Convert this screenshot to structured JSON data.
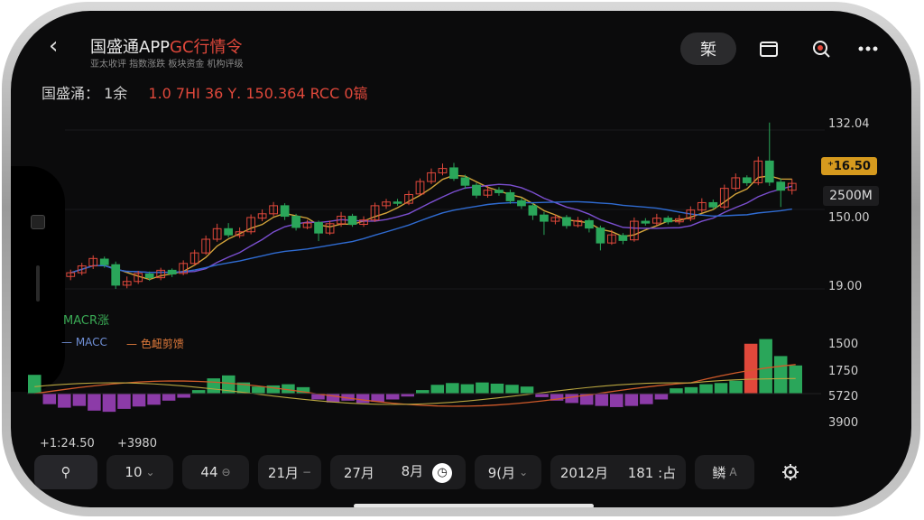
{
  "app": {
    "title_main": "国盛通APP",
    "title_red": "GC行情令",
    "subtitle": "亚太收评 指数涨跌 板块资金 机构评级"
  },
  "header_buttons": {
    "pill": "椠",
    "folder_icon": "folder-icon",
    "search_icon": "search-icon",
    "more_icon": "more-icon"
  },
  "ticker": {
    "name": "国盛涌：",
    "label": "1余",
    "values": "1.0 7ΗΙ  36 Υ.  150.364  RCC 0镐"
  },
  "y_axis_main": [
    "132.04",
    "150.00",
    "19.00"
  ],
  "price_tags": {
    "current": "⁺16.50",
    "volume": "2500M"
  },
  "y_axis_sub": [
    "1500",
    "1750",
    "5720",
    "3900"
  ],
  "labels": {
    "macd_top": "MACR涨",
    "legend_blue": "MACC",
    "legend_red": "色衄剪馈"
  },
  "stats": {
    "left": "+1:24.50",
    "right": "+3980"
  },
  "toolbar": {
    "items": [
      {
        "label": "⚲",
        "icon": "search-filter-icon"
      },
      {
        "label": "10",
        "sub": "⌄"
      },
      {
        "label": "44",
        "sub": "⊖"
      },
      {
        "label": "21月",
        "sub": "−"
      },
      {
        "label": "27月",
        "label2": "8月"
      },
      {
        "label": "9(月",
        "sub": "⌄"
      },
      {
        "label": "2012月",
        "label2": "181 :占"
      },
      {
        "label": "鳞",
        "sub": "A"
      }
    ],
    "settings_icon": "gear-icon"
  },
  "colors": {
    "up": "#e0483b",
    "down": "#2aa65a",
    "ma_fast": "#d2a33a",
    "ma_mid": "#7b4fd0",
    "ma_slow": "#2f6bd1",
    "macd_neg": "#8c3ba8"
  },
  "chart_data": {
    "type": "candlestick",
    "candles": [
      {
        "o": 19.2,
        "c": 19.8,
        "h": 20.3,
        "l": 18.6
      },
      {
        "o": 19.8,
        "c": 20.9,
        "h": 21.4,
        "l": 19.4
      },
      {
        "o": 20.9,
        "c": 22.1,
        "h": 22.6,
        "l": 20.4
      },
      {
        "o": 22.0,
        "c": 21.1,
        "h": 22.4,
        "l": 20.6
      },
      {
        "o": 21.1,
        "c": 17.8,
        "h": 21.6,
        "l": 17.2
      },
      {
        "o": 17.8,
        "c": 18.4,
        "h": 19.2,
        "l": 17.3
      },
      {
        "o": 18.4,
        "c": 19.7,
        "h": 20.1,
        "l": 18.0
      },
      {
        "o": 19.6,
        "c": 19.0,
        "h": 20.0,
        "l": 18.5
      },
      {
        "o": 19.0,
        "c": 20.2,
        "h": 20.6,
        "l": 18.6
      },
      {
        "o": 20.2,
        "c": 19.6,
        "h": 20.5,
        "l": 19.1
      },
      {
        "o": 19.7,
        "c": 21.3,
        "h": 21.8,
        "l": 19.4
      },
      {
        "o": 21.3,
        "c": 23.0,
        "h": 23.5,
        "l": 21.0
      },
      {
        "o": 23.0,
        "c": 25.2,
        "h": 25.8,
        "l": 22.7
      },
      {
        "o": 25.2,
        "c": 26.9,
        "h": 27.7,
        "l": 24.8
      },
      {
        "o": 26.9,
        "c": 25.9,
        "h": 27.8,
        "l": 25.5
      },
      {
        "o": 25.8,
        "c": 26.4,
        "h": 27.1,
        "l": 25.4
      },
      {
        "o": 26.4,
        "c": 28.7,
        "h": 29.2,
        "l": 26.0
      },
      {
        "o": 28.6,
        "c": 29.3,
        "h": 30.0,
        "l": 28.1
      },
      {
        "o": 29.3,
        "c": 30.6,
        "h": 31.2,
        "l": 28.9
      },
      {
        "o": 30.6,
        "c": 28.9,
        "h": 31.0,
        "l": 28.3
      },
      {
        "o": 28.9,
        "c": 27.1,
        "h": 29.3,
        "l": 26.6
      },
      {
        "o": 27.1,
        "c": 27.8,
        "h": 28.3,
        "l": 26.8
      },
      {
        "o": 27.9,
        "c": 26.2,
        "h": 28.2,
        "l": 24.9
      },
      {
        "o": 26.2,
        "c": 27.7,
        "h": 28.2,
        "l": 25.9
      },
      {
        "o": 27.7,
        "c": 28.9,
        "h": 29.6,
        "l": 27.2
      },
      {
        "o": 28.9,
        "c": 27.6,
        "h": 29.3,
        "l": 27.2
      },
      {
        "o": 27.6,
        "c": 28.3,
        "h": 28.9,
        "l": 27.2
      },
      {
        "o": 28.3,
        "c": 30.6,
        "h": 31.1,
        "l": 28.0
      },
      {
        "o": 30.6,
        "c": 31.2,
        "h": 31.7,
        "l": 30.1
      },
      {
        "o": 31.2,
        "c": 31.0,
        "h": 31.7,
        "l": 30.6
      },
      {
        "o": 31.0,
        "c": 32.4,
        "h": 33.0,
        "l": 30.7
      },
      {
        "o": 32.5,
        "c": 34.5,
        "h": 35.0,
        "l": 32.2
      },
      {
        "o": 34.5,
        "c": 35.9,
        "h": 36.6,
        "l": 34.1
      },
      {
        "o": 35.9,
        "c": 36.6,
        "h": 37.4,
        "l": 35.5
      },
      {
        "o": 36.7,
        "c": 35.0,
        "h": 37.5,
        "l": 34.6
      },
      {
        "o": 35.1,
        "c": 33.9,
        "h": 35.6,
        "l": 33.3
      },
      {
        "o": 33.9,
        "c": 32.3,
        "h": 34.3,
        "l": 31.8
      },
      {
        "o": 32.3,
        "c": 33.1,
        "h": 33.8,
        "l": 31.9
      },
      {
        "o": 33.1,
        "c": 32.7,
        "h": 33.6,
        "l": 32.2
      },
      {
        "o": 32.7,
        "c": 31.4,
        "h": 33.2,
        "l": 30.9
      },
      {
        "o": 31.4,
        "c": 30.6,
        "h": 31.9,
        "l": 30.1
      },
      {
        "o": 30.6,
        "c": 29.1,
        "h": 31.0,
        "l": 28.3
      },
      {
        "o": 29.1,
        "c": 28.1,
        "h": 29.6,
        "l": 25.9
      },
      {
        "o": 28.1,
        "c": 28.7,
        "h": 29.2,
        "l": 27.6
      },
      {
        "o": 28.7,
        "c": 27.4,
        "h": 29.1,
        "l": 26.9
      },
      {
        "o": 27.4,
        "c": 28.2,
        "h": 28.8,
        "l": 27.1
      },
      {
        "o": 28.2,
        "c": 27.0,
        "h": 28.6,
        "l": 26.3
      },
      {
        "o": 27.0,
        "c": 24.6,
        "h": 27.4,
        "l": 23.4
      },
      {
        "o": 24.6,
        "c": 25.9,
        "h": 26.7,
        "l": 24.3
      },
      {
        "o": 25.8,
        "c": 25.0,
        "h": 26.2,
        "l": 24.4
      },
      {
        "o": 25.1,
        "c": 28.1,
        "h": 28.7,
        "l": 24.8
      },
      {
        "o": 28.1,
        "c": 27.8,
        "h": 28.6,
        "l": 27.4
      },
      {
        "o": 27.8,
        "c": 28.6,
        "h": 29.3,
        "l": 27.4
      },
      {
        "o": 28.6,
        "c": 28.0,
        "h": 29.0,
        "l": 27.6
      },
      {
        "o": 28.0,
        "c": 28.5,
        "h": 29.1,
        "l": 27.6
      },
      {
        "o": 28.5,
        "c": 29.9,
        "h": 30.5,
        "l": 28.1
      },
      {
        "o": 29.9,
        "c": 31.1,
        "h": 31.8,
        "l": 29.5
      },
      {
        "o": 31.1,
        "c": 30.4,
        "h": 31.6,
        "l": 30.0
      },
      {
        "o": 30.4,
        "c": 33.4,
        "h": 34.0,
        "l": 30.0
      },
      {
        "o": 33.4,
        "c": 35.1,
        "h": 35.8,
        "l": 33.0
      },
      {
        "o": 35.1,
        "c": 34.3,
        "h": 35.5,
        "l": 33.8
      },
      {
        "o": 34.3,
        "c": 37.8,
        "h": 38.5,
        "l": 33.9
      },
      {
        "o": 37.8,
        "c": 34.4,
        "h": 44.0,
        "l": 33.8
      },
      {
        "o": 34.4,
        "c": 33.1,
        "h": 35.0,
        "l": 30.4
      },
      {
        "o": 33.1,
        "c": 34.2,
        "h": 34.9,
        "l": 32.4
      }
    ],
    "volume": [
      3.2,
      -1.8,
      -2.4,
      -2.1,
      -2.9,
      -3.1,
      -2.6,
      -2.2,
      -1.9,
      -1.2,
      -0.7,
      0.6,
      2.6,
      3.1,
      1.9,
      1.2,
      1.4,
      1.6,
      1.1,
      -1.0,
      -1.5,
      -1.2,
      -1.6,
      -1.4,
      -1.0,
      -0.5,
      0.6,
      1.5,
      1.8,
      1.6,
      1.9,
      1.7,
      1.5,
      1.2,
      -0.6,
      -1.2,
      -1.6,
      -1.9,
      -2.1,
      -2.3,
      -2.1,
      -1.8,
      -1.0,
      0.9,
      1.1,
      1.6,
      1.8,
      2.2,
      8.5,
      9.3,
      6.4,
      4.8
    ],
    "ylim": [
      14,
      46
    ]
  }
}
